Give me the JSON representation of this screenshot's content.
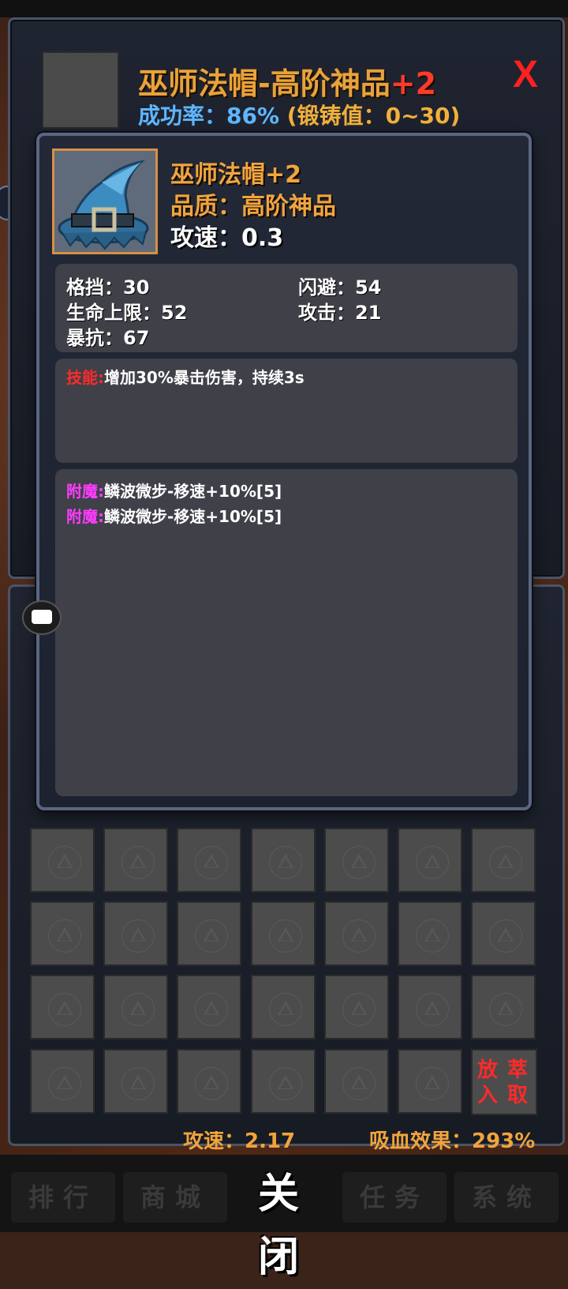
{
  "forge": {
    "title": "巫师法帽-高阶神品",
    "title_plus": "+2",
    "success_label": "成功率：",
    "success_value": "86%",
    "forge_value_text": "(锻铸值：0~30)",
    "close_label": "X"
  },
  "item": {
    "icon": "wizard-hat-icon",
    "name": "巫师法帽+2",
    "quality": "品质：高阶神品",
    "attack_speed": "攻速：0.3"
  },
  "stats": {
    "block": "格挡：30",
    "dodge": "闪避：54",
    "max_hp": "生命上限：52",
    "attack": "攻击：21",
    "crit_resist": "暴抗：67"
  },
  "skill": {
    "tag": "技能:",
    "text": "增加30%暴击伤害，持续3s"
  },
  "enchantments": [
    {
      "tag": "附魔:",
      "text": "鳞波微步-移速+10%[5]"
    },
    {
      "tag": "附魔:",
      "text": "鳞波微步-移速+10%[5]"
    }
  ],
  "inventory": {
    "discard_chars": [
      "放",
      "萃",
      "入",
      "取"
    ]
  },
  "peek": {
    "left": "攻速：2.17",
    "right": "吸血效果：293%"
  },
  "nav": {
    "rank": "排行",
    "shop": "商城",
    "close": "关闭",
    "quest": "任务",
    "system": "系统"
  },
  "colors": {
    "gold": "#f0a540",
    "red": "#ff2a2a",
    "blue": "#5fb6ff",
    "enchant": "#ff3cff"
  }
}
